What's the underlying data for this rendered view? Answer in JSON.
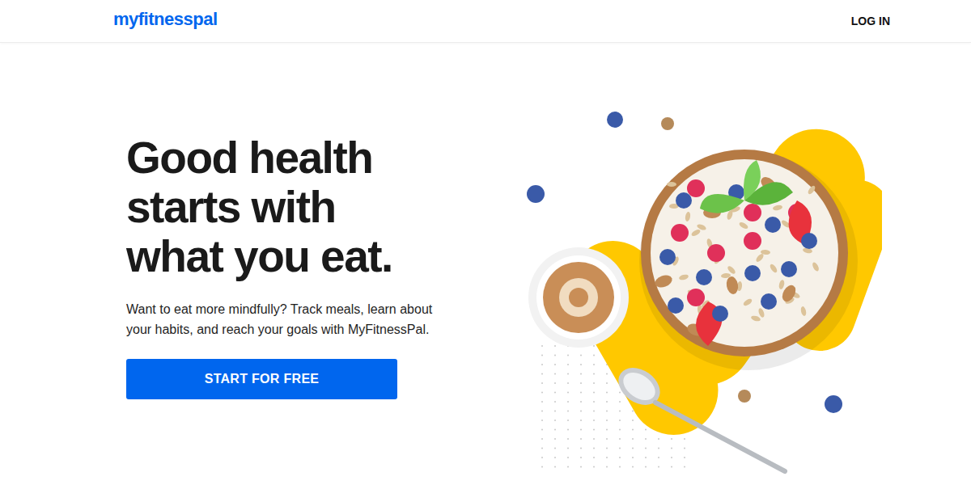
{
  "header": {
    "logo": "myfitnesspal",
    "login": "LOG IN"
  },
  "hero": {
    "title_lines": [
      "Good health",
      "starts with",
      "what you eat."
    ],
    "subtitle_lines": [
      "Want to eat more mindfully? Track meals, learn about",
      "your habits, and reach your goals with MyFitnessPal."
    ],
    "button": "START FOR FREE"
  }
}
